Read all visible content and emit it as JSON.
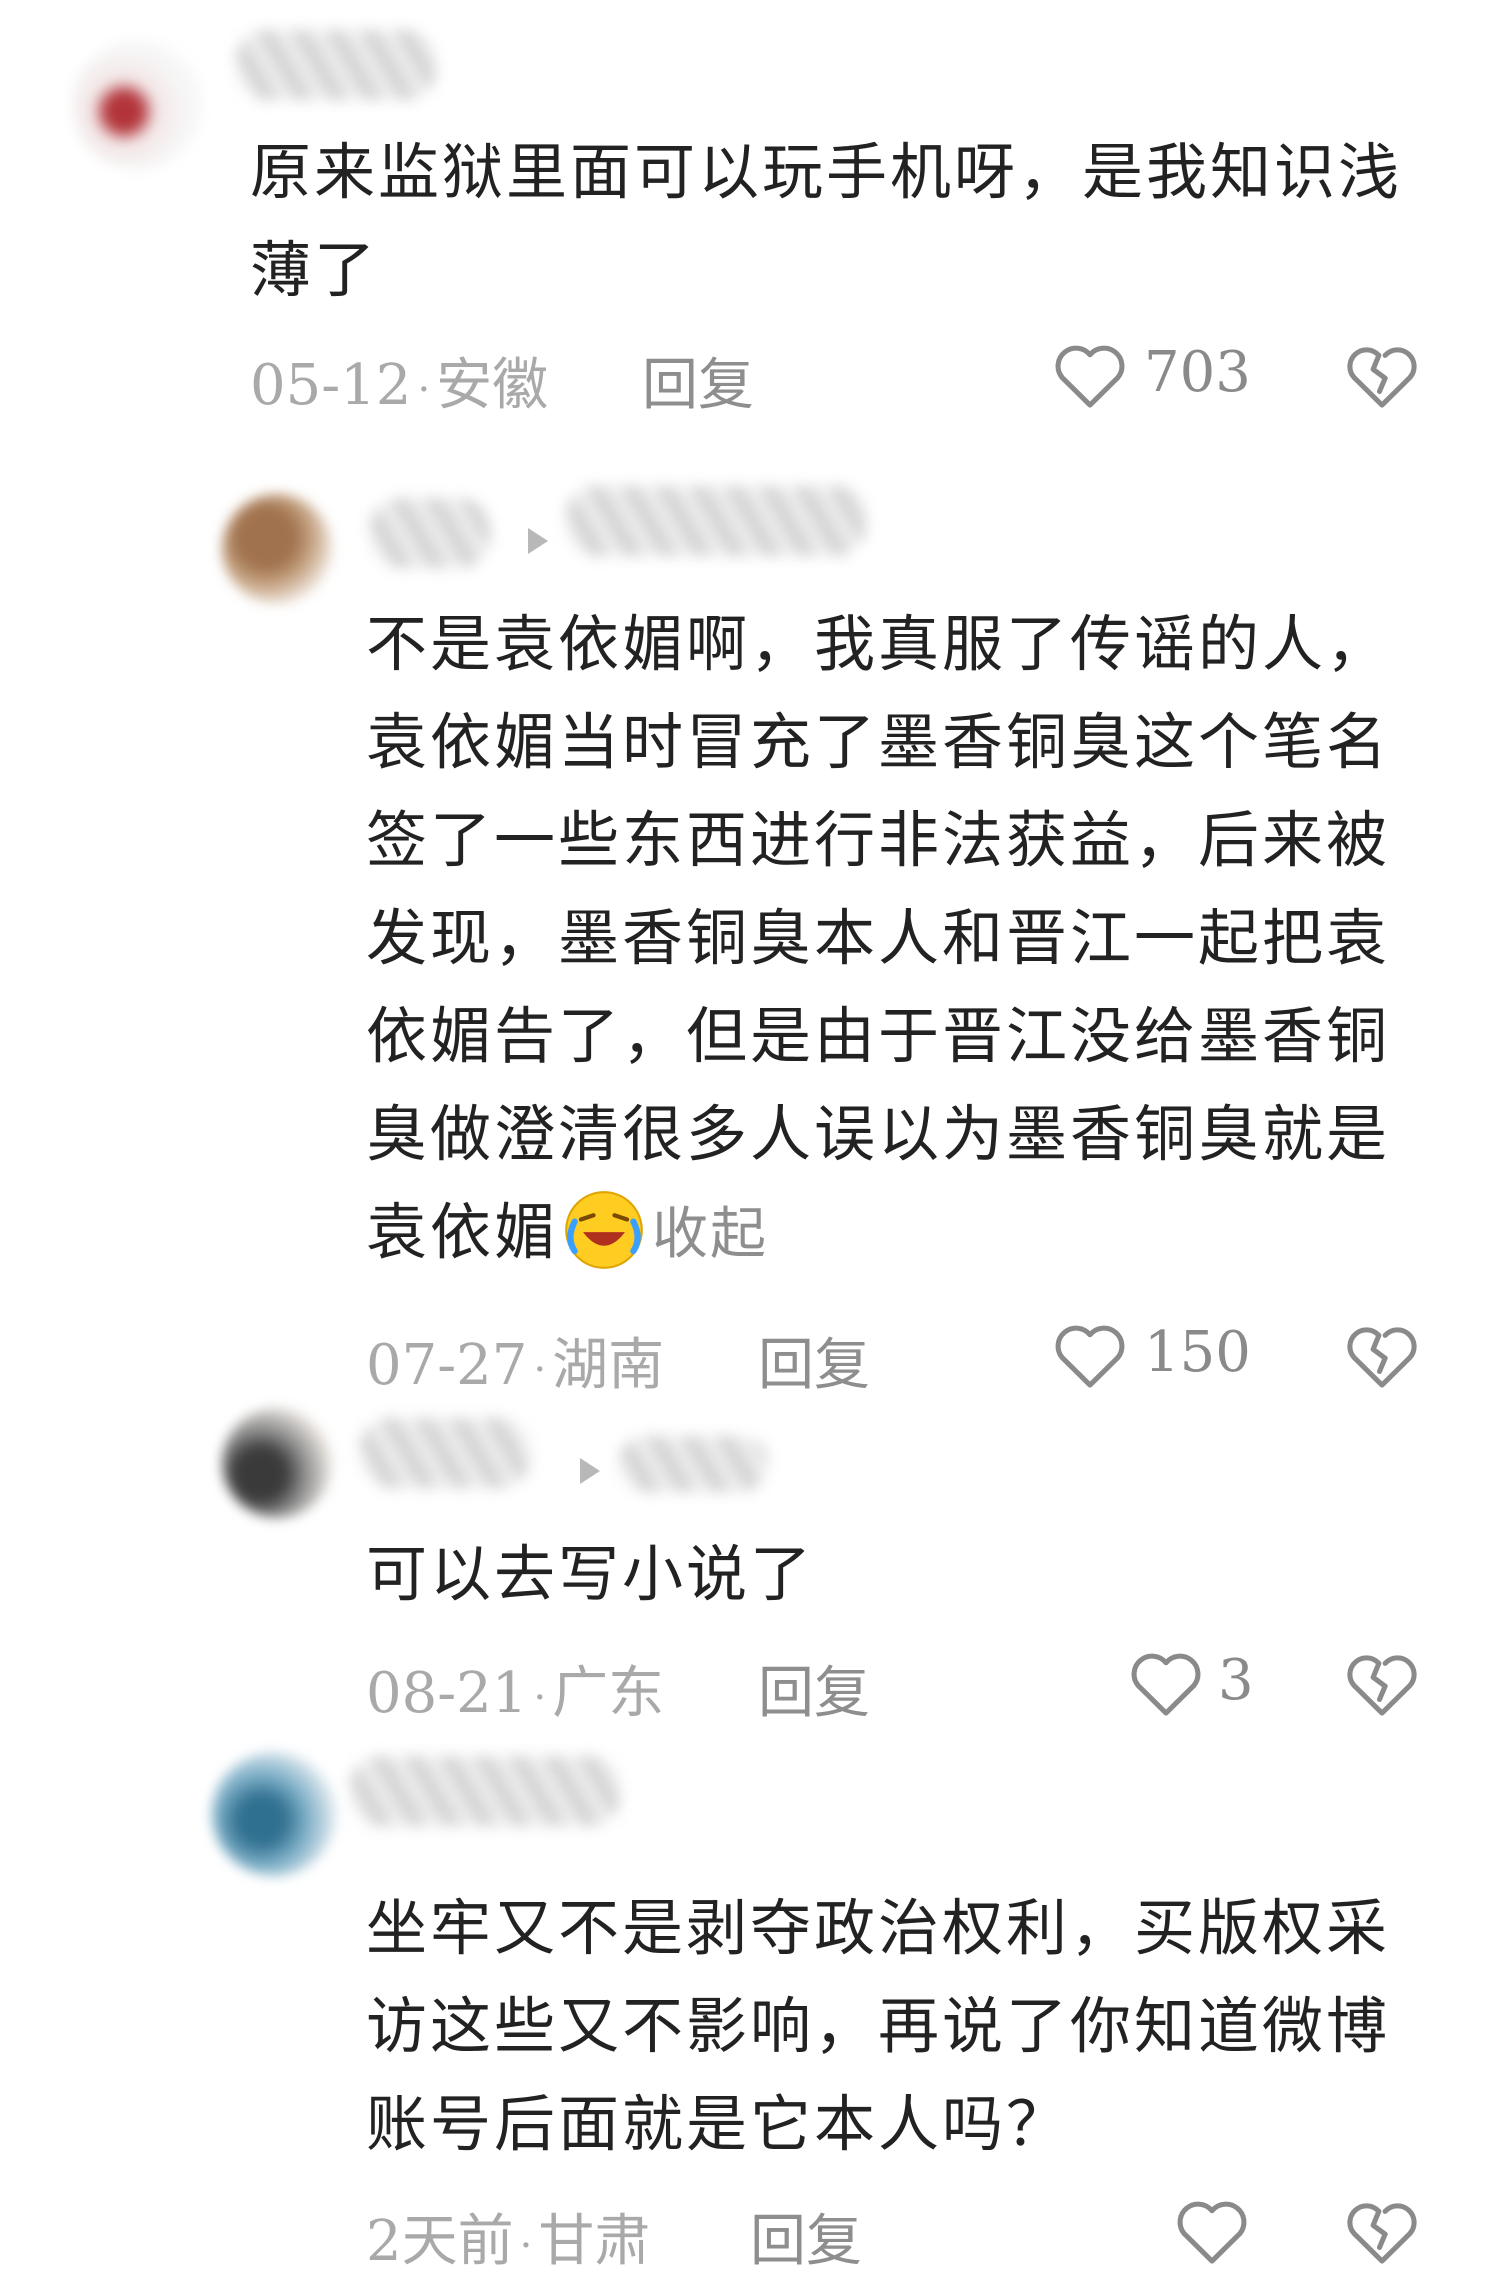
{
  "comments": [
    {
      "text": "原来监狱里面可以玩手机呀，是我知识浅薄了",
      "date": "05-12",
      "location": "安徽",
      "reply_label": "回复",
      "likes": "703"
    },
    {
      "text": "不是袁依媚啊，我真服了传谣的人，袁依媚当时冒充了墨香铜臭这个笔名签了一些东西进行非法获益，后来被发现，墨香铜臭本人和晋江一起把袁依媚告了，但是由于晋江没给墨香铜臭做澄清很多人误以为墨香铜臭就是袁依媚",
      "emoji": "laughing-crying-emoji",
      "collapse_label": "收起",
      "date": "07-27",
      "location": "湖南",
      "reply_label": "回复",
      "likes": "150"
    },
    {
      "text": "可以去写小说了",
      "date": "08-21",
      "location": "广东",
      "reply_label": "回复",
      "likes": "3"
    },
    {
      "text": "坐牢又不是剥夺政治权利，买版权采访这些又不影响，再说了你知道微博账号后面就是它本人吗？",
      "date": "2天前",
      "location": "甘肃",
      "reply_label": "回复",
      "likes": ""
    }
  ],
  "colors": {
    "text": "#222222",
    "meta": "#a9a9a9",
    "icon": "#8a8a8a",
    "background": "#ffffff"
  }
}
